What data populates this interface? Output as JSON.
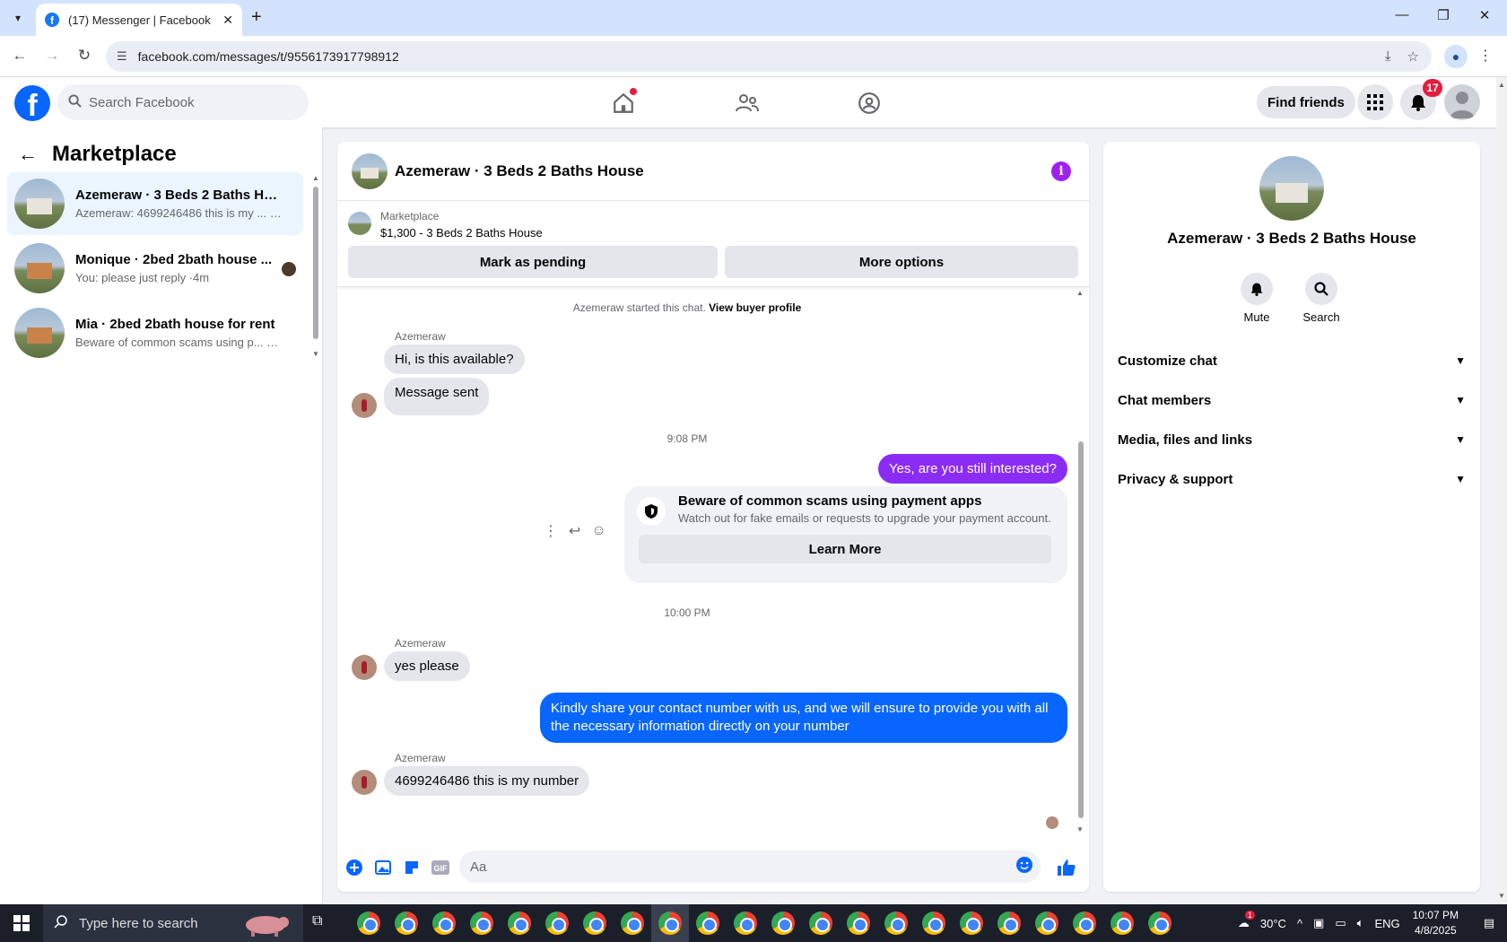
{
  "browser": {
    "tab_title": "(17) Messenger | Facebook",
    "url": "facebook.com/messages/t/9556173917798912"
  },
  "fb_header": {
    "search_placeholder": "Search Facebook",
    "find_friends": "Find friends",
    "notification_count": "17"
  },
  "left": {
    "title": "Marketplace",
    "conversations": [
      {
        "name": "Azemeraw · 3 Beds 2 Baths House",
        "preview": "Azemeraw: 4699246486 this is my ... ·3m"
      },
      {
        "name": "Monique · 2bed 2bath house ...",
        "preview": "You: please just reply ·4m"
      },
      {
        "name": "Mia · 2bed 2bath house for rent",
        "preview": "Beware of common scams using p... ·2w"
      }
    ]
  },
  "chat": {
    "title": "Azemeraw · 3 Beds 2 Baths House",
    "listing_source": "Marketplace",
    "listing_price": "$1,300 - 3 Beds 2 Baths House",
    "mark_pending": "Mark as pending",
    "more_options": "More options",
    "started_text": "Azemeraw started this chat.",
    "view_buyer": "View buyer profile",
    "sender_name": "Azemeraw",
    "msg1": "Hi, is this available?",
    "msg2": "Message sent",
    "time1": "9:08 PM",
    "out1": "Yes, are you still interested?",
    "scam_title": "Beware of common scams using payment apps",
    "scam_desc": "Watch out for fake emails or requests to upgrade your payment account.",
    "learn_more": "Learn More",
    "time2": "10:00 PM",
    "msg3": "yes please",
    "out2": "Kindly share your contact number with us, and we will ensure to provide you with all the necessary information directly on your number",
    "msg4": "4699246486 this is my number",
    "composer_placeholder": "Aa",
    "colors": {
      "outgoing_purple": "#8b2cf5",
      "outgoing_blue": "#0866ff"
    }
  },
  "right": {
    "name": "Azemeraw · 3 Beds 2 Baths House",
    "mute": "Mute",
    "search": "Search",
    "sections": [
      "Customize chat",
      "Chat members",
      "Media, files and links",
      "Privacy & support"
    ]
  },
  "taskbar": {
    "search_placeholder": "Type here to search",
    "temperature": "30°C",
    "language": "ENG",
    "time": "10:07 PM",
    "date": "4/8/2025",
    "weather_badge": "1"
  }
}
